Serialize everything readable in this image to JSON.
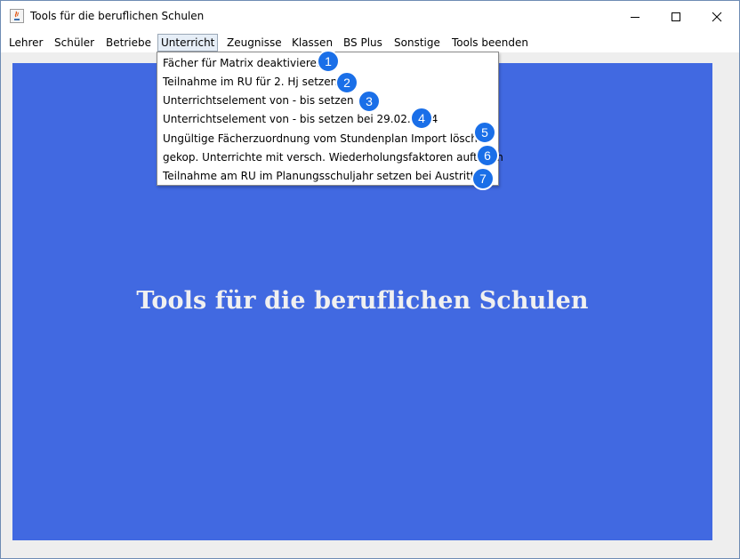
{
  "window": {
    "title": "Tools für die beruflichen Schulen",
    "controls": [
      "minimize-icon",
      "maximize-icon",
      "close-icon"
    ]
  },
  "menubar": {
    "items": [
      {
        "label": "Lehrer"
      },
      {
        "label": "Schüler"
      },
      {
        "label": "Betriebe"
      },
      {
        "label": "Unterricht",
        "active": true
      },
      {
        "label": "Zeugnisse"
      },
      {
        "label": "Klassen"
      },
      {
        "label": "BS Plus"
      },
      {
        "label": "Sonstige"
      },
      {
        "label": "Tools beenden"
      }
    ]
  },
  "dropdown": {
    "items": [
      {
        "label": "Fächer für Matrix deaktivieren",
        "badge": "1"
      },
      {
        "label": "Teilnahme im RU für 2. Hj setzen",
        "badge": "2"
      },
      {
        "label": "Unterrichtselement von - bis setzen",
        "badge": "3"
      },
      {
        "label": "Unterrichtselement von - bis setzen bei 29.02.2024",
        "badge": "4"
      },
      {
        "label": "Ungültige Fächerzuordnung vom Stundenplan Import löschen",
        "badge": "5"
      },
      {
        "label": "gekop. Unterrichte mit versch. Wiederholungsfaktoren aufteilen",
        "badge": "6"
      },
      {
        "label": "Teilnahme am RU im Planungsschuljahr setzen bei Austritt RU",
        "badge": "7"
      }
    ]
  },
  "main": {
    "title": "Tools für die beruflichen Schulen",
    "panel_color": "#4169e1",
    "badge_color": "#1a6fe8"
  }
}
